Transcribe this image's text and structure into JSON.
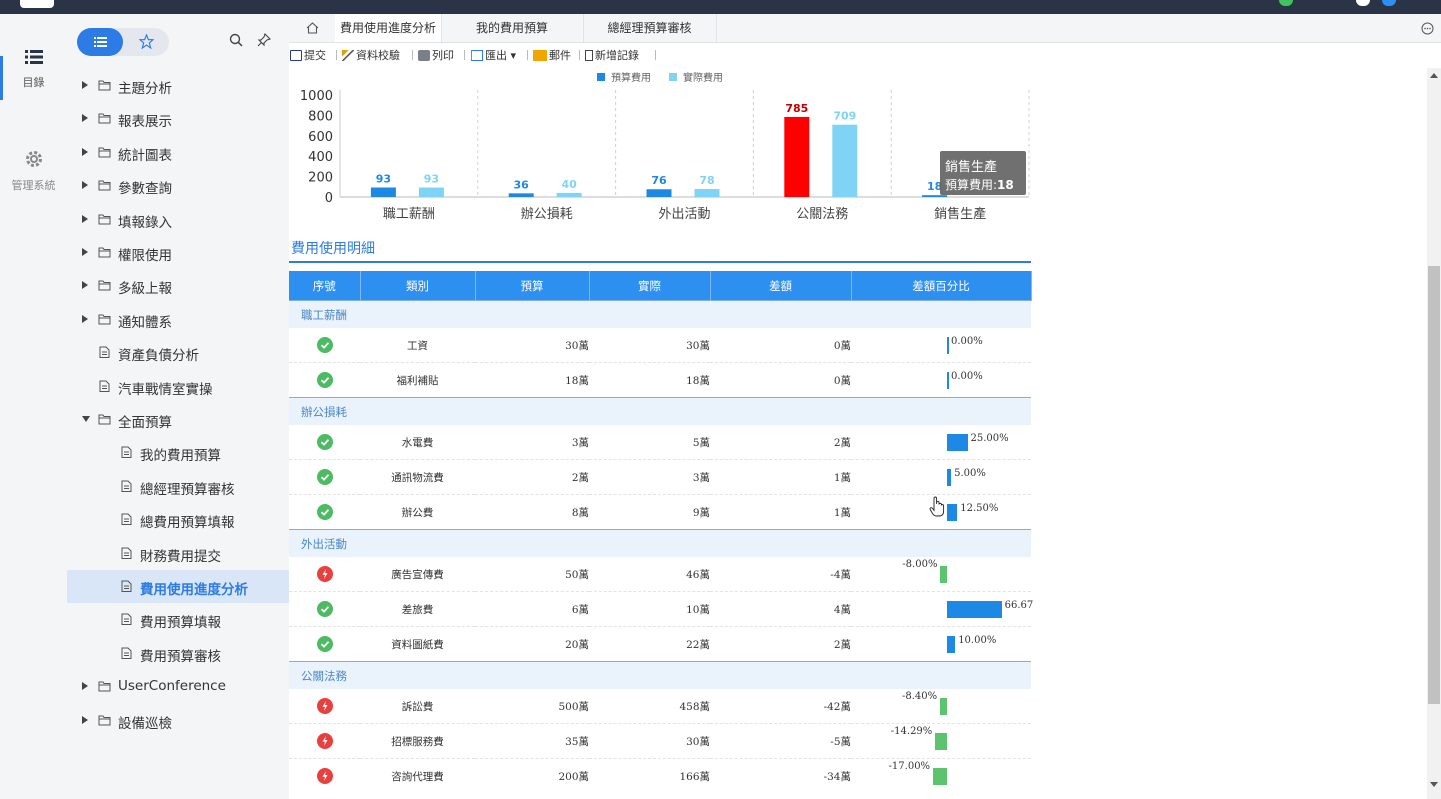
{
  "rail": {
    "catalog_label": "目錄",
    "admin_label": "管理系統"
  },
  "sidebar": {
    "items": [
      {
        "label": "主題分析"
      },
      {
        "label": "報表展示"
      },
      {
        "label": "統計圖表"
      },
      {
        "label": "參數查詢"
      },
      {
        "label": "填報錄入"
      },
      {
        "label": "權限使用"
      },
      {
        "label": "多級上報"
      },
      {
        "label": "通知體系"
      },
      {
        "label": "資產負債分析"
      },
      {
        "label": "汽車戰情室實操"
      },
      {
        "label": "全面預算"
      },
      {
        "label": "我的費用預算"
      },
      {
        "label": "總經理預算審核"
      },
      {
        "label": "總費用預算填報"
      },
      {
        "label": "財務費用提交"
      },
      {
        "label": "費用使用進度分析"
      },
      {
        "label": "費用預算填報"
      },
      {
        "label": "費用預算審核"
      },
      {
        "label": "UserConference"
      },
      {
        "label": "設備巡檢"
      }
    ]
  },
  "tabs": [
    {
      "label": "費用使用進度分析"
    },
    {
      "label": "我的費用預算"
    },
    {
      "label": "總經理預算審核"
    }
  ],
  "toolbar": {
    "submit": "提交",
    "verify": "資料校驗",
    "print": "列印",
    "export": "匯出",
    "mail": "郵件",
    "add": "新增記錄"
  },
  "chart_data": {
    "type": "bar",
    "title": "",
    "categories": [
      "職工薪酬",
      "辦公損耗",
      "外出活動",
      "公關法務",
      "銷售生產"
    ],
    "series": [
      {
        "name": "預算費用",
        "values": [
          93,
          36,
          76,
          785,
          18
        ]
      },
      {
        "name": "實際費用",
        "values": [
          93,
          40,
          78,
          709,
          null
        ]
      }
    ],
    "yticks": [
      "0",
      "200",
      "400",
      "600",
      "800",
      "1000"
    ],
    "ylim": [
      0,
      1000
    ],
    "legend": "top",
    "grid": false,
    "colors": {
      "budget": "#1e88e5",
      "actual": "#7fd4f5",
      "highlight": "#ff0000"
    },
    "tooltip": {
      "title": "銷售生產",
      "label": "預算費用:",
      "value": "18"
    }
  },
  "detail": {
    "title": "費用使用明細",
    "headers": [
      "序號",
      "類別",
      "預算",
      "實際",
      "差額",
      "差額百分比"
    ],
    "groups": [
      {
        "name": "職工薪酬",
        "rows": [
          {
            "status": "ok",
            "item": "工資",
            "budget": "30萬",
            "actual": "30萬",
            "diff": "0萬",
            "pct": "0.00%",
            "pct_value": 0
          },
          {
            "status": "ok",
            "item": "福利補貼",
            "budget": "18萬",
            "actual": "18萬",
            "diff": "0萬",
            "pct": "0.00%",
            "pct_value": 0
          }
        ]
      },
      {
        "name": "辦公損耗",
        "rows": [
          {
            "status": "ok",
            "item": "水電費",
            "budget": "3萬",
            "actual": "5萬",
            "diff": "2萬",
            "pct": "25.00%",
            "pct_value": 25
          },
          {
            "status": "ok",
            "item": "通訊物流費",
            "budget": "2萬",
            "actual": "3萬",
            "diff": "1萬",
            "pct": "5.00%",
            "pct_value": 5
          },
          {
            "status": "ok",
            "item": "辦公費",
            "budget": "8萬",
            "actual": "9萬",
            "diff": "1萬",
            "pct": "12.50%",
            "pct_value": 12.5
          }
        ]
      },
      {
        "name": "外出活動",
        "rows": [
          {
            "status": "bad",
            "item": "廣告宣傳費",
            "budget": "50萬",
            "actual": "46萬",
            "diff": "-4萬",
            "pct": "-8.00%",
            "pct_value": -8
          },
          {
            "status": "ok",
            "item": "差旅費",
            "budget": "6萬",
            "actual": "10萬",
            "diff": "4萬",
            "pct": "66.67",
            "pct_value": 66.67
          },
          {
            "status": "ok",
            "item": "資料圖紙費",
            "budget": "20萬",
            "actual": "22萬",
            "diff": "2萬",
            "pct": "10.00%",
            "pct_value": 10
          }
        ]
      },
      {
        "name": "公關法務",
        "rows": [
          {
            "status": "bad",
            "item": "訴訟費",
            "budget": "500萬",
            "actual": "458萬",
            "diff": "-42萬",
            "pct": "-8.40%",
            "pct_value": -8.4
          },
          {
            "status": "bad",
            "item": "招標服務費",
            "budget": "35萬",
            "actual": "30萬",
            "diff": "-5萬",
            "pct": "-14.29%",
            "pct_value": -14.29
          },
          {
            "status": "bad",
            "item": "咨詢代理費",
            "budget": "200萬",
            "actual": "166萬",
            "diff": "-34萬",
            "pct": "-17.00%",
            "pct_value": -17
          }
        ]
      }
    ],
    "colors": {
      "positive": "#1e88e5",
      "negative": "#5cc46e"
    }
  }
}
